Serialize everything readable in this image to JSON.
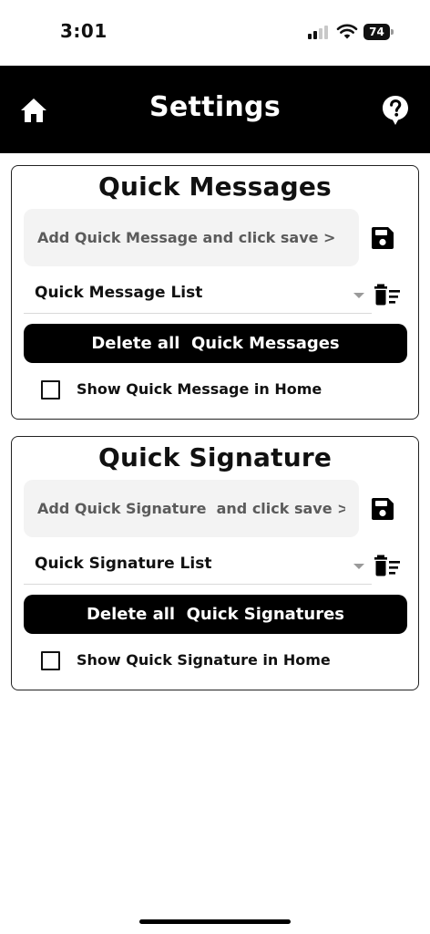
{
  "status_bar": {
    "time": "3:01",
    "battery": "74",
    "icons": [
      "signal-icon",
      "wifi-icon",
      "battery-icon"
    ]
  },
  "app_bar": {
    "title": "Settings",
    "left_icon": "home-icon",
    "right_icon": "help-icon"
  },
  "quick_messages": {
    "title": "Quick Messages",
    "input_placeholder": "Add Quick Message and click save >",
    "dropdown_label": "Quick Message List",
    "delete_button": "Delete all  Quick Messages",
    "checkbox_label": "Show Quick Message in Home",
    "checked": false
  },
  "quick_signature": {
    "title": "Quick Signature",
    "input_placeholder": "Add Quick Signature  and click save >",
    "dropdown_label": "Quick Signature List",
    "delete_button": "Delete all  Quick Signatures",
    "checkbox_label": "Show Quick Signature in Home",
    "checked": false
  },
  "colors": {
    "app_bar_bg": "#000000",
    "input_bg": "#f3f3f3",
    "button_bg": "#000000"
  }
}
